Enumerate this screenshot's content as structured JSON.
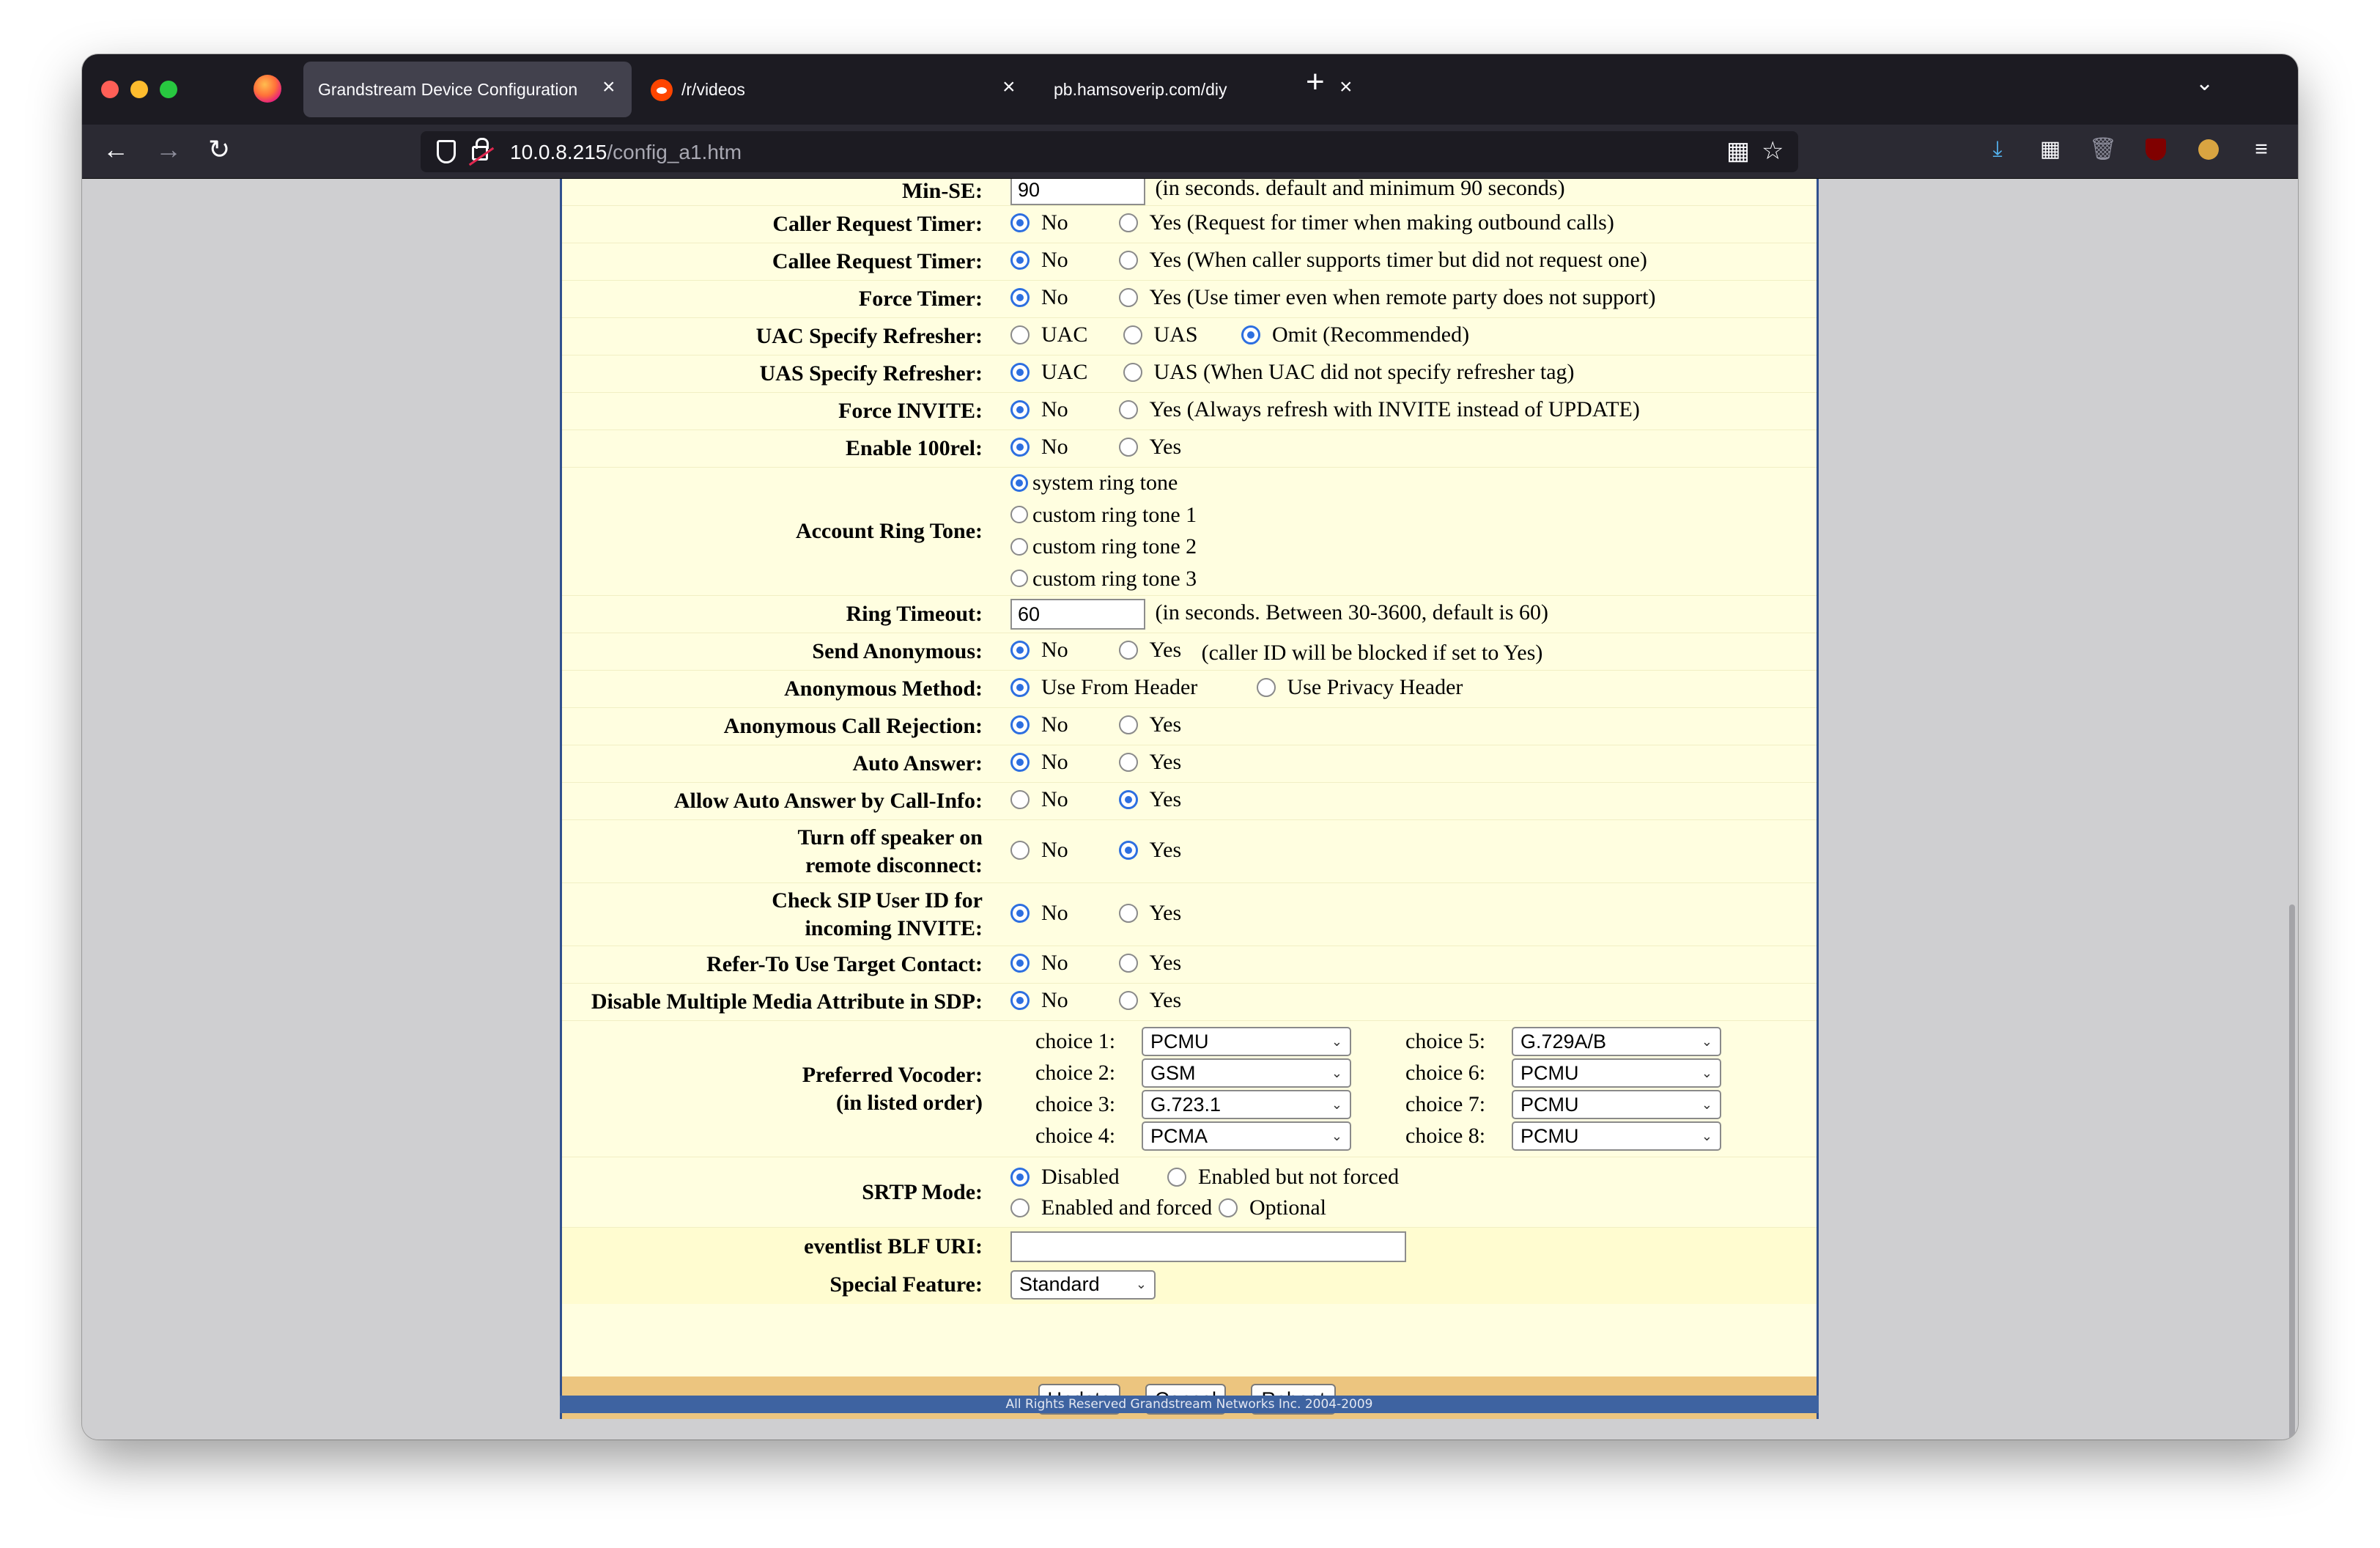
{
  "browser": {
    "tabs": [
      {
        "title": "Grandstream Device Configuration",
        "active": true
      },
      {
        "title": "/r/videos",
        "active": false
      },
      {
        "title": "pb.hamsoverip.com/diy",
        "active": false
      }
    ],
    "url_host": "10.0.8.215",
    "url_path": "/config_a1.htm",
    "colors": {
      "tabbar": "#1c1b22",
      "navbar": "#2b2a33",
      "active_tab": "#42414d"
    }
  },
  "page": {
    "colors": {
      "background": "#fffee0",
      "border": "#30508e",
      "button_bar": "#ecc57f",
      "footer": "#3e63a1"
    },
    "rows": {
      "min_se": {
        "label": "Min-SE:",
        "value": "90",
        "note": "(in seconds. default and minimum 90 seconds)"
      },
      "caller_timer": {
        "label": "Caller Request Timer:",
        "opt1": "No",
        "opt2": "Yes (Request for timer when making outbound calls)",
        "selected": "No"
      },
      "callee_timer": {
        "label": "Callee Request Timer:",
        "opt1": "No",
        "opt2": "Yes (When caller supports timer but did not request one)",
        "selected": "No"
      },
      "force_timer": {
        "label": "Force Timer:",
        "opt1": "No",
        "opt2": "Yes (Use timer even when remote party does not support)",
        "selected": "No"
      },
      "uac_refresher": {
        "label": "UAC Specify Refresher:",
        "opt1": "UAC",
        "opt2": "UAS",
        "opt3": "Omit (Recommended)",
        "selected": "Omit (Recommended)"
      },
      "uas_refresher": {
        "label": "UAS Specify Refresher:",
        "opt1": "UAC",
        "opt2": "UAS (When UAC did not specify refresher tag)",
        "selected": "UAC"
      },
      "force_invite": {
        "label": "Force INVITE:",
        "opt1": "No",
        "opt2": "Yes (Always refresh with INVITE instead of UPDATE)",
        "selected": "No"
      },
      "enable_100rel": {
        "label": "Enable 100rel:",
        "opt1": "No",
        "opt2": "Yes",
        "selected": "No"
      },
      "ring_tone": {
        "label": "Account Ring Tone:",
        "opt1": "system ring tone",
        "opt2": "custom ring tone 1",
        "opt3": "custom ring tone 2",
        "opt4": "custom ring tone 3",
        "selected": "system ring tone"
      },
      "ring_timeout": {
        "label": "Ring Timeout:",
        "value": "60",
        "note": "(in seconds. Between 30-3600, default is 60)"
      },
      "send_anon": {
        "label": "Send Anonymous:",
        "opt1": "No",
        "opt2": "Yes",
        "note": "(caller ID will be blocked if set to Yes)",
        "selected": "No"
      },
      "anon_method": {
        "label": "Anonymous Method:",
        "opt1": "Use From Header",
        "opt2": "Use Privacy Header",
        "selected": "Use From Header"
      },
      "anon_reject": {
        "label": "Anonymous Call Rejection:",
        "opt1": "No",
        "opt2": "Yes",
        "selected": "No"
      },
      "auto_answer": {
        "label": "Auto Answer:",
        "opt1": "No",
        "opt2": "Yes",
        "selected": "No"
      },
      "auto_answer_callinfo": {
        "label": "Allow Auto Answer by Call-Info:",
        "opt1": "No",
        "opt2": "Yes",
        "selected": "Yes"
      },
      "speaker_off": {
        "label_line1": "Turn off speaker on",
        "label_line2": "remote disconnect:",
        "opt1": "No",
        "opt2": "Yes",
        "selected": "Yes"
      },
      "check_sip": {
        "label_line1": "Check SIP User ID for",
        "label_line2": "incoming INVITE:",
        "opt1": "No",
        "opt2": "Yes",
        "selected": "No"
      },
      "refer_to": {
        "label": "Refer-To Use Target Contact:",
        "opt1": "No",
        "opt2": "Yes",
        "selected": "No"
      },
      "disable_mma": {
        "label": "Disable Multiple Media Attribute in SDP:",
        "opt1": "No",
        "opt2": "Yes",
        "selected": "No"
      },
      "vocoder": {
        "label_line1": "Preferred Vocoder:",
        "label_line2": "(in listed order)",
        "choices": [
          {
            "label": "choice 1:",
            "value": "PCMU"
          },
          {
            "label": "choice 2:",
            "value": "GSM"
          },
          {
            "label": "choice 3:",
            "value": "G.723.1"
          },
          {
            "label": "choice 4:",
            "value": "PCMA"
          },
          {
            "label": "choice 5:",
            "value": "G.729A/B"
          },
          {
            "label": "choice 6:",
            "value": "PCMU"
          },
          {
            "label": "choice 7:",
            "value": "PCMU"
          },
          {
            "label": "choice 8:",
            "value": "PCMU"
          }
        ]
      },
      "srtp": {
        "label": "SRTP Mode:",
        "opt1": "Disabled",
        "opt2": "Enabled but not forced",
        "opt3": "Enabled and forced",
        "opt4": "Optional",
        "selected": "Disabled"
      },
      "eventlist": {
        "label": "eventlist BLF URI:",
        "value": ""
      },
      "special": {
        "label": "Special Feature:",
        "value": "Standard"
      }
    },
    "buttons": {
      "update": "Update",
      "cancel": "Cancel",
      "reboot": "Reboot"
    },
    "footer": "All Rights Reserved Grandstream Networks Inc. 2004-2009"
  }
}
